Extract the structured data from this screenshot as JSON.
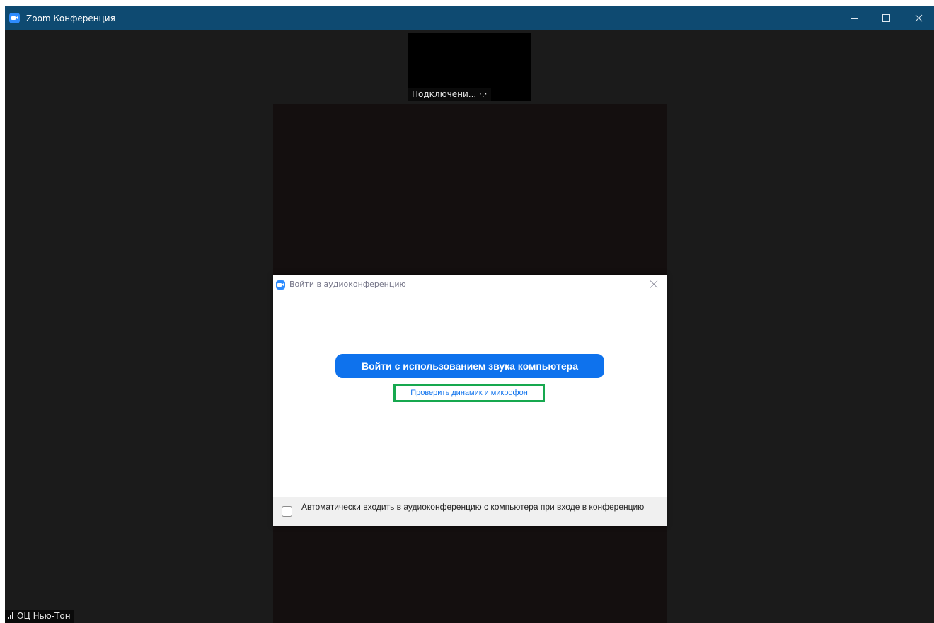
{
  "window": {
    "title": "Zoom Конференция",
    "controls": {
      "minimize_icon": "minimize-icon",
      "maximize_icon": "maximize-icon",
      "close_icon": "close-icon"
    }
  },
  "video": {
    "thumbnail_label": "Подключени... ·.·",
    "participant_name": "ОЦ Нью-Тон",
    "signal_icon": "signal-strength-icon"
  },
  "audio_dialog": {
    "title": "Войти в аудиоконференцию",
    "join_button_label": "Войти с использованием звука компьютера",
    "test_link_label": "Проверить динамик и микрофон",
    "auto_join_label": "Автоматически входить в аудиоконференцию с компьютера при входе в конференцию",
    "auto_join_checked": false
  },
  "colors": {
    "titlebar": "#0e4a71",
    "primary_button": "#0e72ed",
    "highlight_border": "#17a84f",
    "zoom_icon": "#2d8cff"
  }
}
